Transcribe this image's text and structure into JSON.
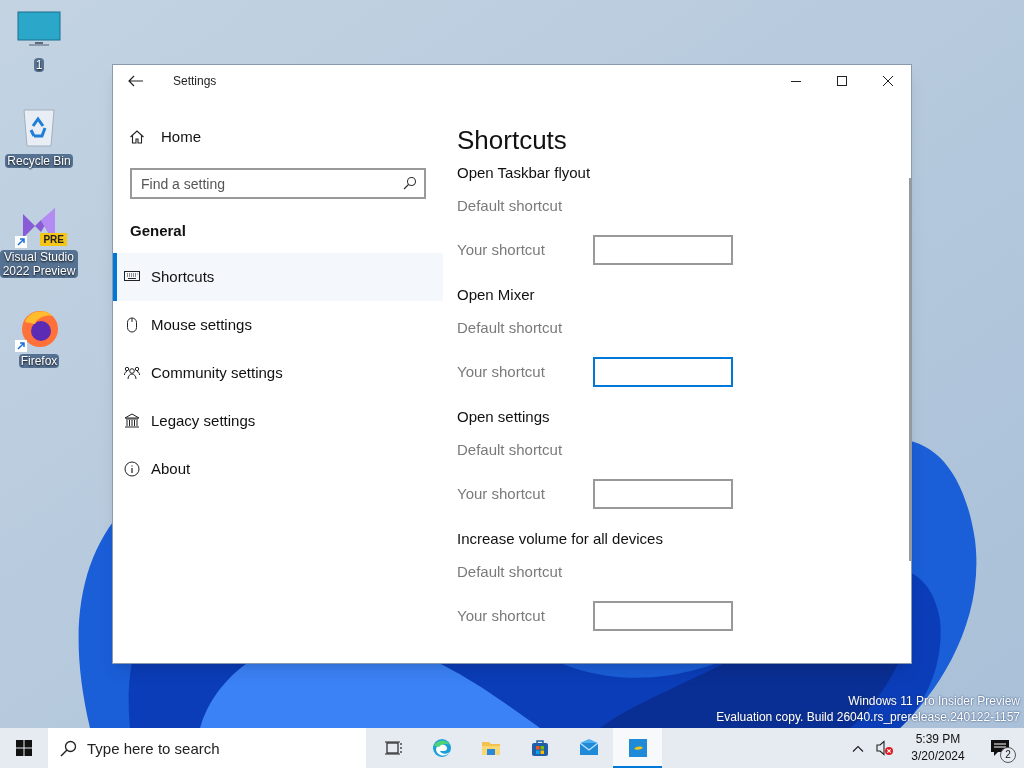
{
  "desktop_icons": [
    {
      "kind": "monitor",
      "label": "1"
    },
    {
      "kind": "recycle",
      "label": "Recycle Bin"
    },
    {
      "kind": "vs",
      "label": "Visual Studio 2022 Preview",
      "badge": "PRE",
      "shortcut": true
    },
    {
      "kind": "firefox",
      "label": "Firefox",
      "shortcut": true
    }
  ],
  "window": {
    "title": "Settings",
    "sidebar": {
      "home": "Home",
      "search": {
        "placeholder": "Find a setting"
      },
      "section": "General",
      "items": [
        {
          "kind": "keyboard",
          "label": "Shortcuts",
          "selected": true
        },
        {
          "kind": "mouse",
          "label": "Mouse settings",
          "selected": false
        },
        {
          "kind": "people",
          "label": "Community settings",
          "selected": false
        },
        {
          "kind": "bank",
          "label": "Legacy settings",
          "selected": false
        },
        {
          "kind": "info",
          "label": "About",
          "selected": false
        }
      ]
    },
    "content": {
      "heading": "Shortcuts",
      "groups": [
        {
          "title": "Open Taskbar flyout",
          "default_label": "Default shortcut",
          "your_label": "Your shortcut",
          "focused": false
        },
        {
          "title": "Open Mixer",
          "default_label": "Default shortcut",
          "your_label": "Your shortcut",
          "focused": true
        },
        {
          "title": "Open settings",
          "default_label": "Default shortcut",
          "your_label": "Your shortcut",
          "focused": false
        },
        {
          "title": "Increase volume for all devices",
          "default_label": "Default shortcut",
          "your_label": "Your shortcut",
          "focused": false
        }
      ]
    }
  },
  "desktop_watermark": [
    "Windows 11 Pro Insider Preview",
    "Evaluation copy. Build 26040.rs_prerelease.240122-1157"
  ],
  "taskbar": {
    "search": {
      "placeholder": "Type here to search"
    },
    "apps": [
      {
        "kind": "taskview",
        "active": false
      },
      {
        "kind": "edge",
        "active": false
      },
      {
        "kind": "explorer",
        "active": false
      },
      {
        "kind": "store",
        "active": false
      },
      {
        "kind": "mail",
        "active": false
      },
      {
        "kind": "app",
        "active": true
      }
    ],
    "time": "5:39 PM",
    "date": "3/20/2024",
    "notifications": "2"
  }
}
